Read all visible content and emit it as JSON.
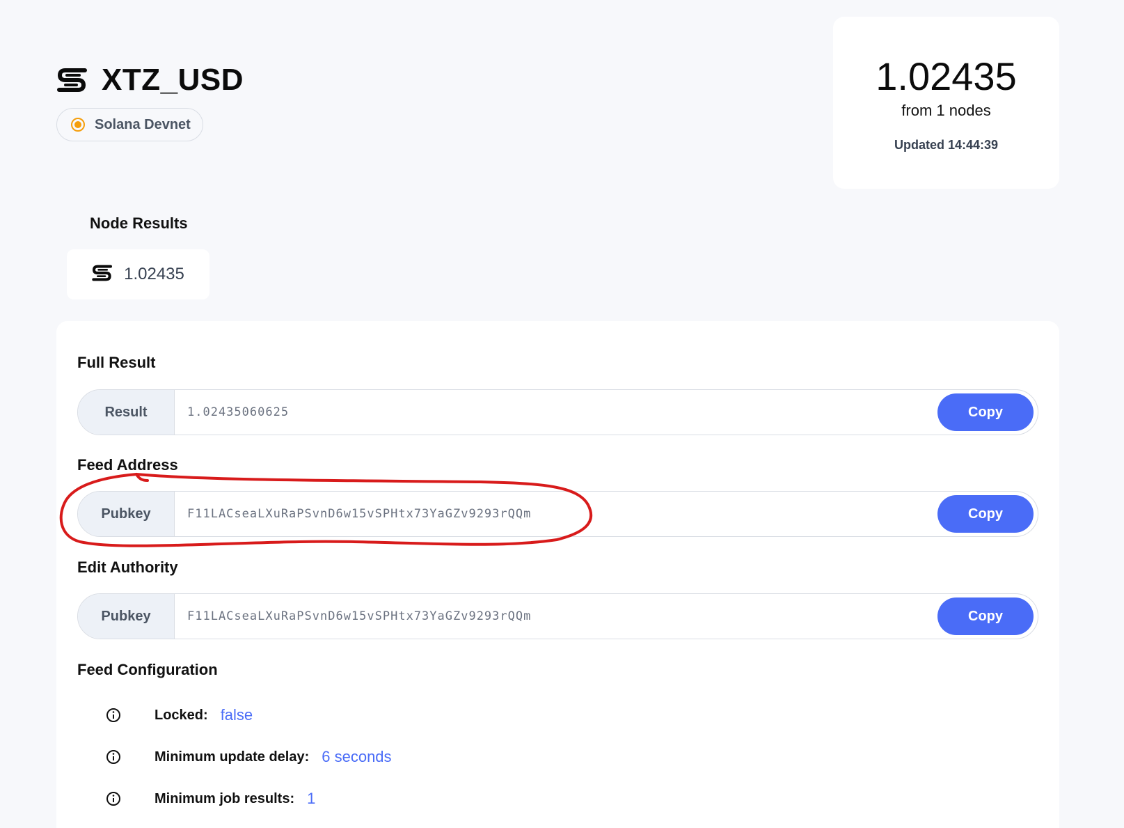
{
  "header": {
    "title": "XTZ_USD",
    "network": "Solana Devnet",
    "network_status_color": "#f59e0b",
    "logo_icon": "switchboard-logo-icon"
  },
  "price_card": {
    "value": "1.02435",
    "nodes_text": "from 1 nodes",
    "updated_text": "Updated 14:44:39"
  },
  "node_results": {
    "heading": "Node Results",
    "items": [
      {
        "icon": "switchboard-logo-icon",
        "value": "1.02435"
      }
    ]
  },
  "full_result": {
    "heading": "Full Result",
    "prefix": "Result",
    "value": "1.02435060625",
    "copy_label": "Copy"
  },
  "feed_address": {
    "heading": "Feed Address",
    "prefix": "Pubkey",
    "value": "F11LACseaLXuRaPSvnD6w15vSPHtx73YaGZv9293rQQm",
    "copy_label": "Copy"
  },
  "edit_authority": {
    "heading": "Edit Authority",
    "prefix": "Pubkey",
    "value": "F11LACseaLXuRaPSvnD6w15vSPHtx73YaGZv9293rQQm",
    "copy_label": "Copy"
  },
  "feed_configuration": {
    "heading": "Feed Configuration",
    "items": [
      {
        "icon": "info-icon",
        "label": "Locked:",
        "value": "false"
      },
      {
        "icon": "info-icon",
        "label": "Minimum update delay:",
        "value": "6 seconds"
      },
      {
        "icon": "info-icon",
        "label": "Minimum job results:",
        "value": "1"
      }
    ]
  },
  "colors": {
    "accent": "#4a6cf7",
    "annotation": "#d81b1b",
    "background": "#f7f8fb"
  }
}
